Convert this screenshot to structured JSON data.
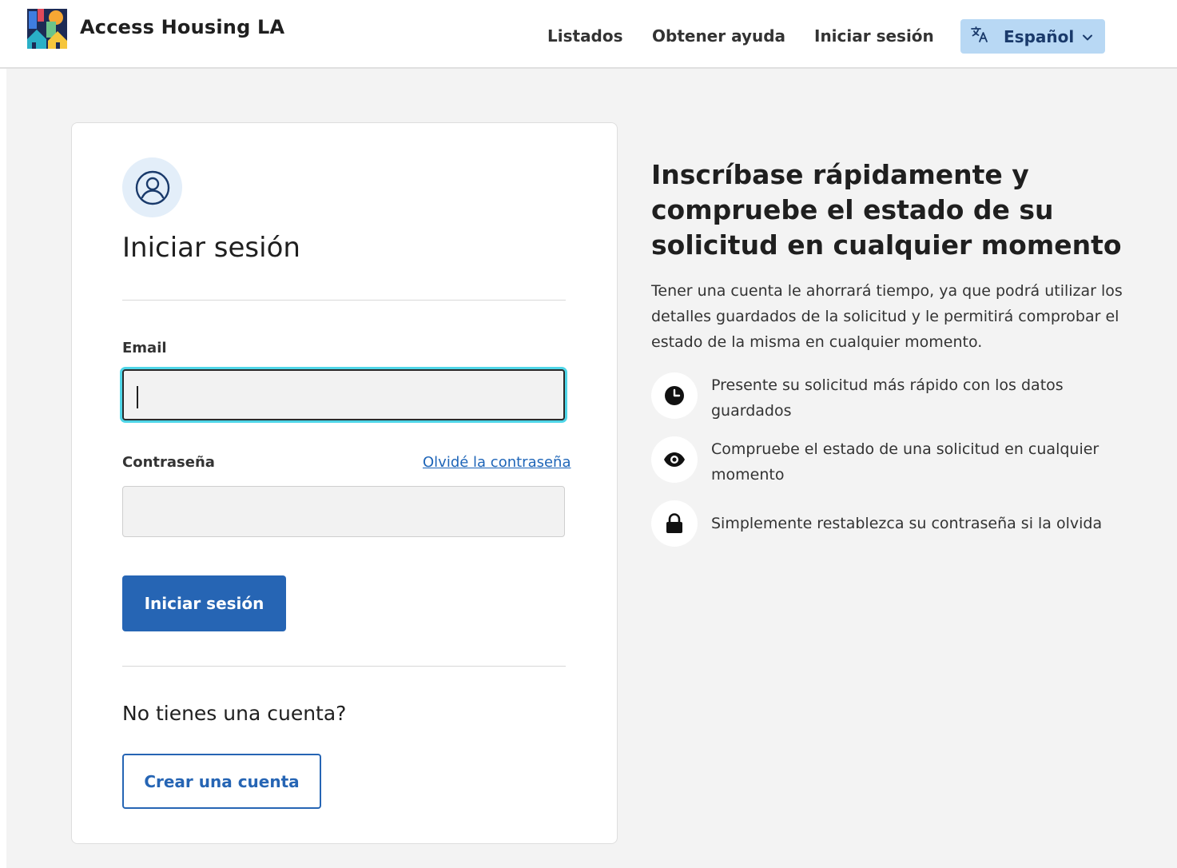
{
  "header": {
    "brand": "Access Housing LA",
    "nav": {
      "listings": "Listados",
      "help": "Obtener ayuda",
      "sign_in": "Iniciar sesión"
    },
    "language": {
      "icon": "translate-icon",
      "label": "Español"
    }
  },
  "card": {
    "title": "Iniciar sesión",
    "email_label": "Email",
    "email_value": "",
    "password_label": "Contraseña",
    "forgot_link": "Olvidé la contraseña",
    "password_value": "",
    "submit_label": "Iniciar sesión",
    "no_account": "No tienes una cuenta?",
    "create_account_label": "Crear una cuenta"
  },
  "info": {
    "title": "Inscríbase rápidamente y compruebe el estado de su solicitud en cualquier momento",
    "description": "Tener una cuenta le ahorrará tiempo, ya que podrá utilizar los detalles guardados de la solicitud y le permitirá comprobar el estado de la misma en cualquier momento.",
    "benefits": [
      {
        "icon": "clock-icon",
        "text": "Presente su solicitud más rápido con los datos guardados"
      },
      {
        "icon": "eye-icon",
        "text": "Compruebe el estado de una solicitud en cualquier momento"
      },
      {
        "icon": "lock-icon",
        "text": "Simplemente restablezca su contraseña si la olvida"
      }
    ]
  },
  "colors": {
    "primary": "#2665b4",
    "language_bg": "#b8d8f4",
    "focus_ring": "#4fd6e8",
    "page_bg": "#f3f3f3"
  }
}
